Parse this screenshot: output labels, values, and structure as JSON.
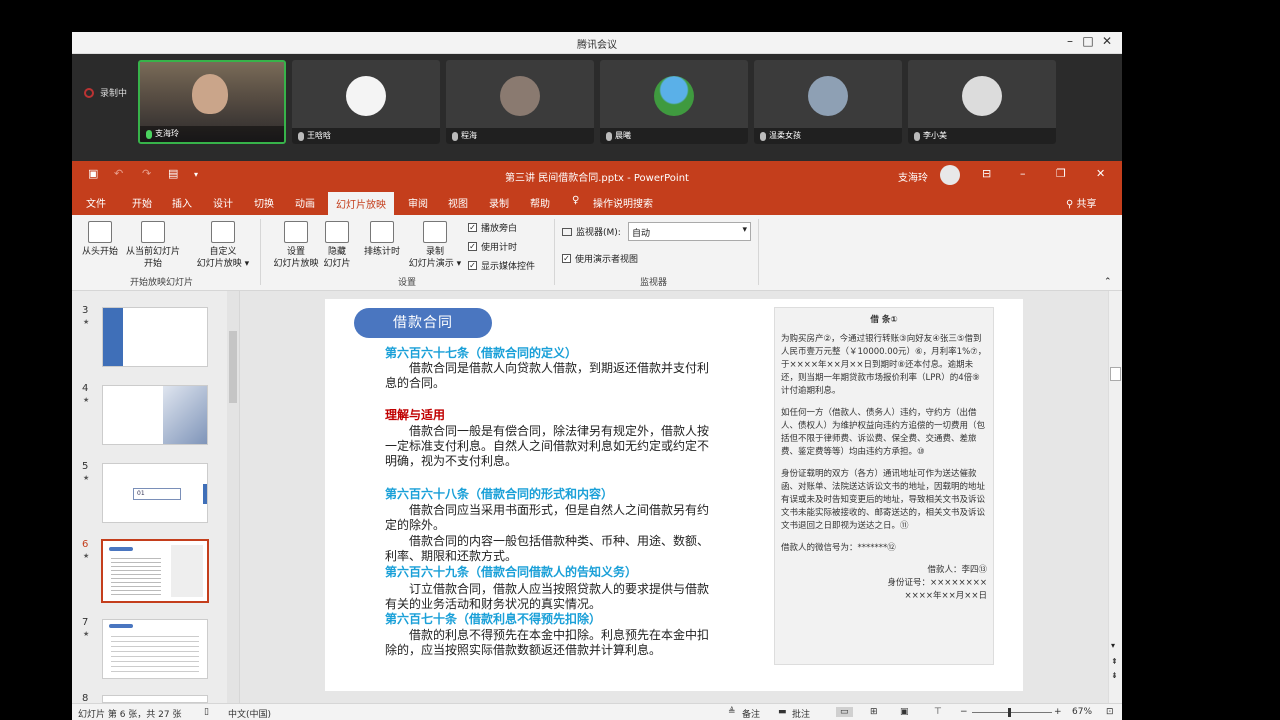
{
  "meeting": {
    "title": "腾讯会议",
    "recording": "录制中",
    "participants": [
      {
        "name": "支海玲",
        "mic": "on",
        "kind": "camera"
      },
      {
        "name": "王晗晗",
        "mic": "muted",
        "kind": "avatar",
        "color": "#f4f4f4"
      },
      {
        "name": "程海",
        "mic": "muted",
        "kind": "avatar",
        "color": "#8a7a70"
      },
      {
        "name": "晨曦",
        "mic": "muted",
        "kind": "avatar",
        "color": "#3f9a3f"
      },
      {
        "name": "温柔女孩",
        "mic": "muted",
        "kind": "avatar",
        "color": "#8ea0b4"
      },
      {
        "name": "李小美",
        "mic": "muted",
        "kind": "avatar",
        "color": "#dcdcdc"
      }
    ]
  },
  "ppt": {
    "title": "第三讲 民间借款合同.pptx - PowerPoint",
    "user": "支海玲",
    "share": "共享",
    "accent": "#c43e1c",
    "tabs": [
      "文件",
      "开始",
      "插入",
      "设计",
      "切换",
      "动画",
      "幻灯片放映",
      "审阅",
      "视图",
      "录制",
      "帮助",
      "操作说明搜索"
    ],
    "selected_tab": "幻灯片放映",
    "ribbon": {
      "from_start": "从头开始",
      "from_current_1": "从当前幻灯片",
      "from_current_2": "开始",
      "custom_1": "自定义",
      "custom_2": "幻灯片放映",
      "group_start": "开始放映幻灯片",
      "setup_1": "设置",
      "setup_2": "幻灯片放映",
      "hide_1": "隐藏",
      "hide_2": "幻灯片",
      "rehearse": "排练计时",
      "record_1": "录制",
      "record_2": "幻灯片演示",
      "chk_narration": "播放旁白",
      "chk_timing": "使用计时",
      "chk_media": "显示媒体控件",
      "group_setup": "设置",
      "monitor_label": "监视器(M):",
      "monitor_value": "自动",
      "presenter_view": "使用演示者视图",
      "group_monitor": "监视器"
    },
    "thumbs": [
      {
        "num": "3"
      },
      {
        "num": "4"
      },
      {
        "num": "5",
        "label": "01"
      },
      {
        "num": "6",
        "selected": true
      },
      {
        "num": "7"
      },
      {
        "num": "8"
      }
    ],
    "status": {
      "slide": "幻灯片 第 6 张，共 27 张",
      "lang": "中文(中国)",
      "notes": "备注",
      "comments": "批注",
      "zoom": "67%"
    }
  },
  "slide": {
    "pill": "借款合同",
    "art667": "第六百六十七条（借款合同的定义）",
    "art667_body": "借款合同是借款人向贷款人借款，到期返还借款并支付利息的合同。",
    "understand": "理解与适用",
    "understand_body": "借款合同一般是有偿合同，除法律另有规定外，借款人按一定标准支付利息。自然人之间借款对利息如无约定或约定不明确，视为不支付利息。",
    "art668": "第六百六十八条（借款合同的形式和内容）",
    "art668_body1": "借款合同应当采用书面形式，但是自然人之间借款另有约定的除外。",
    "art668_body2": "借款合同的内容一般包括借款种类、币种、用途、数额、利率、期限和还款方式。",
    "art669": "第六百六十九条（借款合同借款人的告知义务）",
    "art669_body": "订立借款合同，借款人应当按照贷款人的要求提供与借款有关的业务活动和财务状况的真实情况。",
    "art670": "第六百七十条（借款利息不得预先扣除）",
    "art670_body": "借款的利息不得预先在本金中扣除。利息预先在本金中扣除的，应当按照实际借款数额返还借款并计算利息。",
    "note": {
      "title": "借 条①",
      "p1": "为购买房产②，今通过银行转账③向好友④张三⑤借到人民币壹万元整（￥10000.00元）⑥，月利率1%⑦，于××××年××月××日到期时⑧还本付息。逾期未还，则当期一年期贷款市场报价利率（LPR）的4倍⑨计付逾期利息。",
      "p2": "如任何一方（借款人、债务人）违约，守约方（出借人、债权人）为维护权益向违约方追偿的一切费用（包括但不限于律师费、诉讼费、保全费、交通费、差旅费、鉴定费等等）均由违约方承担。⑩",
      "p3": "身份证载明的双方（各方）通讯地址可作为送达催款函、对账单、法院送达诉讼文书的地址，因载明的地址有误或未及时告知变更后的地址，导致相关文书及诉讼文书未能实际被接收的、邮寄送达的，相关文书及诉讼文书退回之日即视为送达之日。⑪",
      "p4": "借款人的微信号为：*******⑫",
      "sign1": "借款人：李四⑬",
      "sign2": "身份证号：××××××××",
      "sign3": "××××年××月××日"
    }
  }
}
